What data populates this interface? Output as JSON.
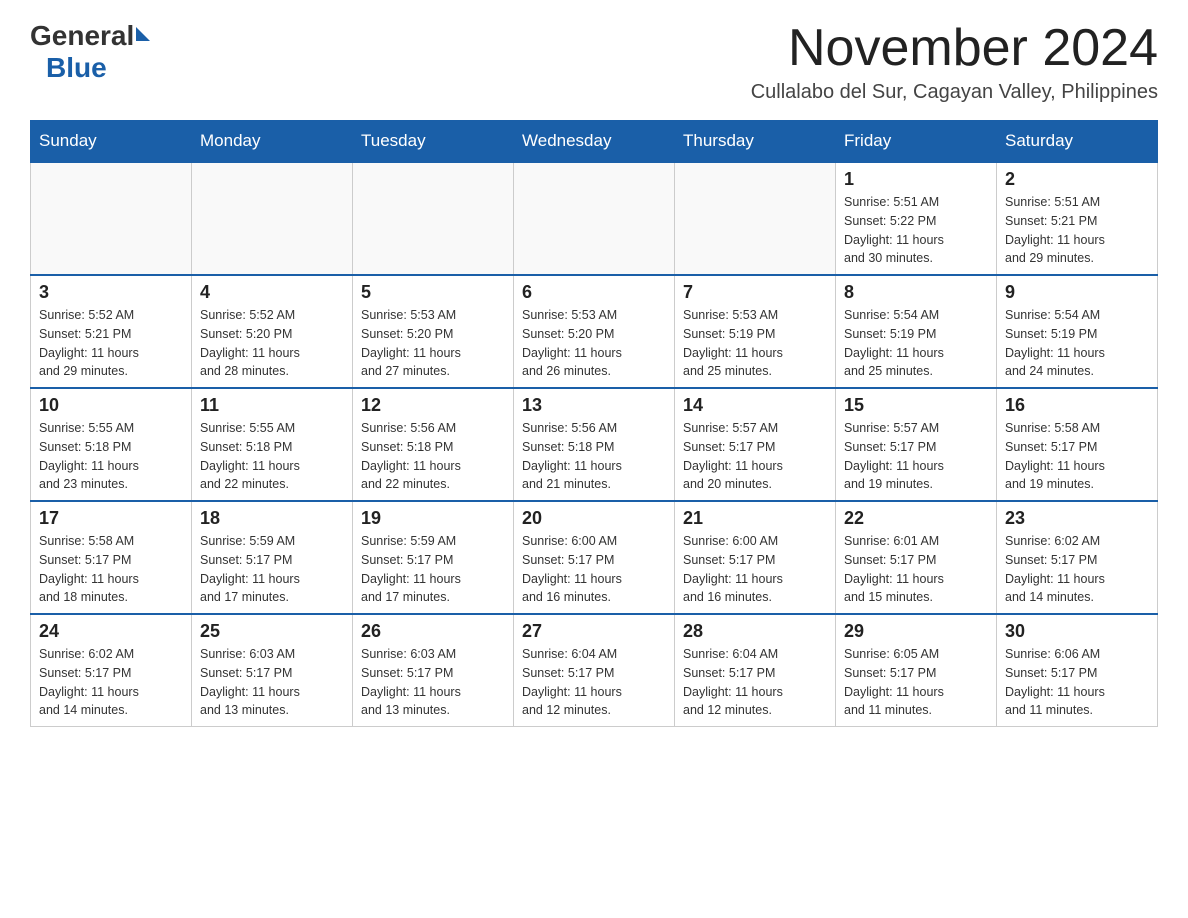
{
  "logo": {
    "general_text": "General",
    "blue_text": "Blue"
  },
  "title": "November 2024",
  "location": "Cullalabo del Sur, Cagayan Valley, Philippines",
  "days_of_week": [
    "Sunday",
    "Monday",
    "Tuesday",
    "Wednesday",
    "Thursday",
    "Friday",
    "Saturday"
  ],
  "weeks": [
    [
      {
        "day": "",
        "info": ""
      },
      {
        "day": "",
        "info": ""
      },
      {
        "day": "",
        "info": ""
      },
      {
        "day": "",
        "info": ""
      },
      {
        "day": "",
        "info": ""
      },
      {
        "day": "1",
        "info": "Sunrise: 5:51 AM\nSunset: 5:22 PM\nDaylight: 11 hours\nand 30 minutes."
      },
      {
        "day": "2",
        "info": "Sunrise: 5:51 AM\nSunset: 5:21 PM\nDaylight: 11 hours\nand 29 minutes."
      }
    ],
    [
      {
        "day": "3",
        "info": "Sunrise: 5:52 AM\nSunset: 5:21 PM\nDaylight: 11 hours\nand 29 minutes."
      },
      {
        "day": "4",
        "info": "Sunrise: 5:52 AM\nSunset: 5:20 PM\nDaylight: 11 hours\nand 28 minutes."
      },
      {
        "day": "5",
        "info": "Sunrise: 5:53 AM\nSunset: 5:20 PM\nDaylight: 11 hours\nand 27 minutes."
      },
      {
        "day": "6",
        "info": "Sunrise: 5:53 AM\nSunset: 5:20 PM\nDaylight: 11 hours\nand 26 minutes."
      },
      {
        "day": "7",
        "info": "Sunrise: 5:53 AM\nSunset: 5:19 PM\nDaylight: 11 hours\nand 25 minutes."
      },
      {
        "day": "8",
        "info": "Sunrise: 5:54 AM\nSunset: 5:19 PM\nDaylight: 11 hours\nand 25 minutes."
      },
      {
        "day": "9",
        "info": "Sunrise: 5:54 AM\nSunset: 5:19 PM\nDaylight: 11 hours\nand 24 minutes."
      }
    ],
    [
      {
        "day": "10",
        "info": "Sunrise: 5:55 AM\nSunset: 5:18 PM\nDaylight: 11 hours\nand 23 minutes."
      },
      {
        "day": "11",
        "info": "Sunrise: 5:55 AM\nSunset: 5:18 PM\nDaylight: 11 hours\nand 22 minutes."
      },
      {
        "day": "12",
        "info": "Sunrise: 5:56 AM\nSunset: 5:18 PM\nDaylight: 11 hours\nand 22 minutes."
      },
      {
        "day": "13",
        "info": "Sunrise: 5:56 AM\nSunset: 5:18 PM\nDaylight: 11 hours\nand 21 minutes."
      },
      {
        "day": "14",
        "info": "Sunrise: 5:57 AM\nSunset: 5:17 PM\nDaylight: 11 hours\nand 20 minutes."
      },
      {
        "day": "15",
        "info": "Sunrise: 5:57 AM\nSunset: 5:17 PM\nDaylight: 11 hours\nand 19 minutes."
      },
      {
        "day": "16",
        "info": "Sunrise: 5:58 AM\nSunset: 5:17 PM\nDaylight: 11 hours\nand 19 minutes."
      }
    ],
    [
      {
        "day": "17",
        "info": "Sunrise: 5:58 AM\nSunset: 5:17 PM\nDaylight: 11 hours\nand 18 minutes."
      },
      {
        "day": "18",
        "info": "Sunrise: 5:59 AM\nSunset: 5:17 PM\nDaylight: 11 hours\nand 17 minutes."
      },
      {
        "day": "19",
        "info": "Sunrise: 5:59 AM\nSunset: 5:17 PM\nDaylight: 11 hours\nand 17 minutes."
      },
      {
        "day": "20",
        "info": "Sunrise: 6:00 AM\nSunset: 5:17 PM\nDaylight: 11 hours\nand 16 minutes."
      },
      {
        "day": "21",
        "info": "Sunrise: 6:00 AM\nSunset: 5:17 PM\nDaylight: 11 hours\nand 16 minutes."
      },
      {
        "day": "22",
        "info": "Sunrise: 6:01 AM\nSunset: 5:17 PM\nDaylight: 11 hours\nand 15 minutes."
      },
      {
        "day": "23",
        "info": "Sunrise: 6:02 AM\nSunset: 5:17 PM\nDaylight: 11 hours\nand 14 minutes."
      }
    ],
    [
      {
        "day": "24",
        "info": "Sunrise: 6:02 AM\nSunset: 5:17 PM\nDaylight: 11 hours\nand 14 minutes."
      },
      {
        "day": "25",
        "info": "Sunrise: 6:03 AM\nSunset: 5:17 PM\nDaylight: 11 hours\nand 13 minutes."
      },
      {
        "day": "26",
        "info": "Sunrise: 6:03 AM\nSunset: 5:17 PM\nDaylight: 11 hours\nand 13 minutes."
      },
      {
        "day": "27",
        "info": "Sunrise: 6:04 AM\nSunset: 5:17 PM\nDaylight: 11 hours\nand 12 minutes."
      },
      {
        "day": "28",
        "info": "Sunrise: 6:04 AM\nSunset: 5:17 PM\nDaylight: 11 hours\nand 12 minutes."
      },
      {
        "day": "29",
        "info": "Sunrise: 6:05 AM\nSunset: 5:17 PM\nDaylight: 11 hours\nand 11 minutes."
      },
      {
        "day": "30",
        "info": "Sunrise: 6:06 AM\nSunset: 5:17 PM\nDaylight: 11 hours\nand 11 minutes."
      }
    ]
  ]
}
